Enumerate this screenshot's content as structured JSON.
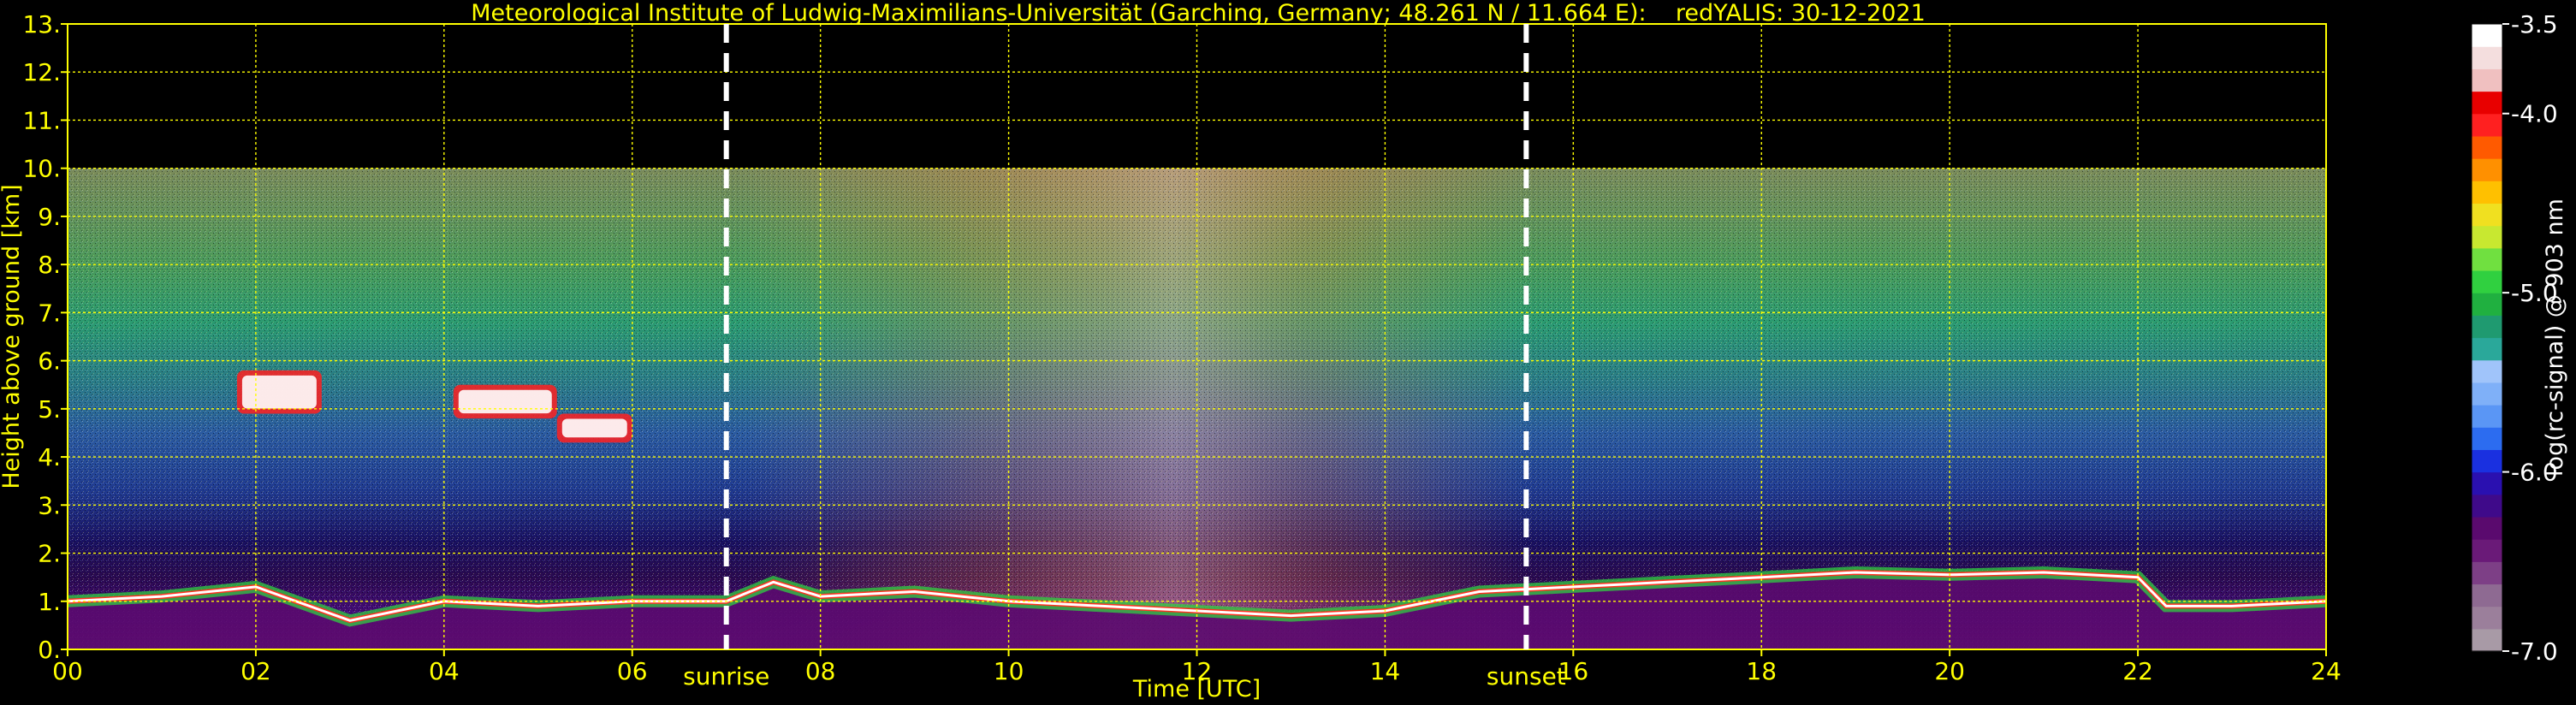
{
  "chart_data": {
    "type": "heatmap",
    "title": "Meteorological Institute of Ludwig-Maximilians-Universität (Garching, Germany; 48.261 N / 11.664 E):    redYALIS: 30-12-2021",
    "xlabel": "Time [UTC]",
    "ylabel": "Height above ground [km]",
    "xlim": [
      0,
      24
    ],
    "ylim": [
      0,
      13
    ],
    "x_ticks": [
      "00",
      "02",
      "04",
      "06",
      "08",
      "10",
      "12",
      "14",
      "16",
      "18",
      "20",
      "22",
      "24"
    ],
    "y_ticks": [
      "0.",
      "1.",
      "2.",
      "3.",
      "4.",
      "5.",
      "6.",
      "7.",
      "8.",
      "9.",
      "10.",
      "11.",
      "12.",
      "13."
    ],
    "grid": true,
    "data_top_km": 10,
    "colorbar": {
      "label": "log(rc-signal) @ 903 nm",
      "range": [
        -7.0,
        -3.5
      ],
      "ticks": [
        "-3.5",
        "-4.0",
        "-5.0",
        "-6.0",
        "-7.0"
      ],
      "colors": [
        "#a89aa6",
        "#9b7f9b",
        "#8e6a92",
        "#7d3f86",
        "#6a1a78",
        "#5a0a6e",
        "#3f0a8a",
        "#2a10b0",
        "#1a30e0",
        "#2c6cf0",
        "#5a96f5",
        "#7fb0f8",
        "#a0c4fa",
        "#2aa89a",
        "#1f9a70",
        "#20b040",
        "#30d040",
        "#70e040",
        "#c8e830",
        "#f0e020",
        "#ffc000",
        "#ff9000",
        "#ff5a00",
        "#ff2020",
        "#e80000",
        "#f0c0c0",
        "#f4dede",
        "#ffffff"
      ]
    },
    "annotations": [
      {
        "text": "sunrise",
        "x": 7.0
      },
      {
        "text": "sunset",
        "x": 15.5
      }
    ],
    "boundary_layer_height_km": {
      "x": [
        0,
        1,
        2,
        3,
        4,
        5,
        6,
        7,
        7.5,
        8,
        9,
        10,
        11,
        12,
        13,
        14,
        15,
        16,
        17,
        18,
        19,
        20,
        21,
        22,
        22.3,
        23,
        24
      ],
      "y": [
        1.0,
        1.1,
        1.3,
        0.6,
        1.0,
        0.9,
        1.0,
        1.0,
        1.4,
        1.1,
        1.2,
        1.0,
        0.9,
        0.8,
        0.7,
        0.8,
        1.2,
        1.3,
        1.4,
        1.5,
        1.6,
        1.55,
        1.6,
        1.5,
        0.9,
        0.9,
        1.0
      ]
    },
    "cloud_layers": [
      {
        "x_start": 1.8,
        "x_end": 2.7,
        "y_bottom": 4.9,
        "y_top": 5.8
      },
      {
        "x_start": 4.1,
        "x_end": 5.2,
        "y_bottom": 4.8,
        "y_top": 5.5
      },
      {
        "x_start": 5.2,
        "x_end": 6.0,
        "y_bottom": 4.3,
        "y_top": 4.9
      }
    ]
  }
}
